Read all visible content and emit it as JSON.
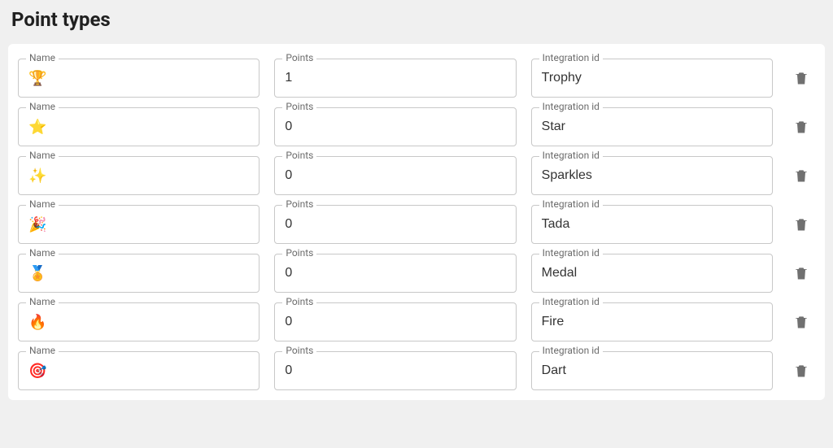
{
  "page": {
    "title": "Point types"
  },
  "labels": {
    "name": "Name",
    "points": "Points",
    "integration_id": "Integration id"
  },
  "rows": [
    {
      "name": "🏆",
      "points": "1",
      "integration_id": "Trophy"
    },
    {
      "name": "⭐",
      "points": "0",
      "integration_id": "Star"
    },
    {
      "name": "✨",
      "points": "0",
      "integration_id": "Sparkles"
    },
    {
      "name": "🎉",
      "points": "0",
      "integration_id": "Tada"
    },
    {
      "name": "🏅",
      "points": "0",
      "integration_id": "Medal"
    },
    {
      "name": "🔥",
      "points": "0",
      "integration_id": "Fire"
    },
    {
      "name": "🎯",
      "points": "0",
      "integration_id": "Dart"
    }
  ]
}
